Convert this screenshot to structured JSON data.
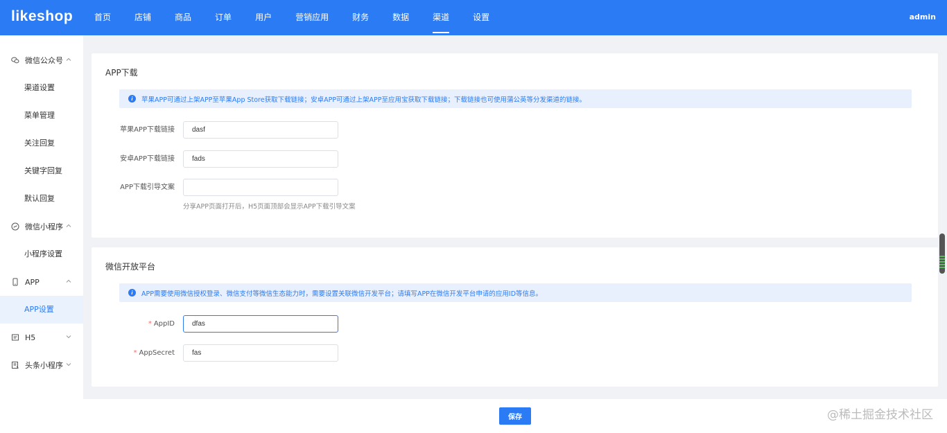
{
  "brand": "likeshop",
  "top_nav": [
    "首页",
    "店铺",
    "商品",
    "订单",
    "用户",
    "营销应用",
    "财务",
    "数据",
    "渠道",
    "设置"
  ],
  "user": "admin",
  "sidebar": {
    "wechat_official": {
      "label": "微信公众号",
      "items": [
        "渠道设置",
        "菜单管理",
        "关注回复",
        "关键字回复",
        "默认回复"
      ]
    },
    "mini_program": {
      "label": "微信小程序",
      "items": [
        "小程序设置"
      ]
    },
    "app": {
      "label": "APP",
      "items": [
        "APP设置"
      ]
    },
    "h5": {
      "label": "H5"
    },
    "toutiao": {
      "label": "头条小程序"
    }
  },
  "app_download": {
    "title": "APP下载",
    "alert": "苹果APP可通过上架APP至苹果App Store获取下载链接；安卓APP可通过上架APP至应用宝获取下载链接；下载链接也可使用蒲公英等分发渠道的链接。",
    "ios_label": "苹果APP下载链接",
    "ios_value": "dasf",
    "android_label": "安卓APP下载链接",
    "android_value": "fads",
    "guide_label": "APP下载引导文案",
    "guide_value": "",
    "guide_hint": "分享APP页面打开后，H5页面顶部会显示APP下载引导文案"
  },
  "open_platform": {
    "title": "微信开放平台",
    "alert": "APP需要使用微信授权登录、微信支付等微信生态能力时，需要设置关联微信开发平台；请填写APP在微信开发平台申请的应用ID等信息。",
    "appid_label": "AppID",
    "appid_value": "dfas",
    "secret_label": "AppSecret",
    "secret_value": "fas"
  },
  "save_label": "保存",
  "watermark": "@稀土掘金技术社区",
  "colors": {
    "primary": "#2b7bf4",
    "alert_bg": "#e8f0fe",
    "required": "#f56c6c"
  }
}
